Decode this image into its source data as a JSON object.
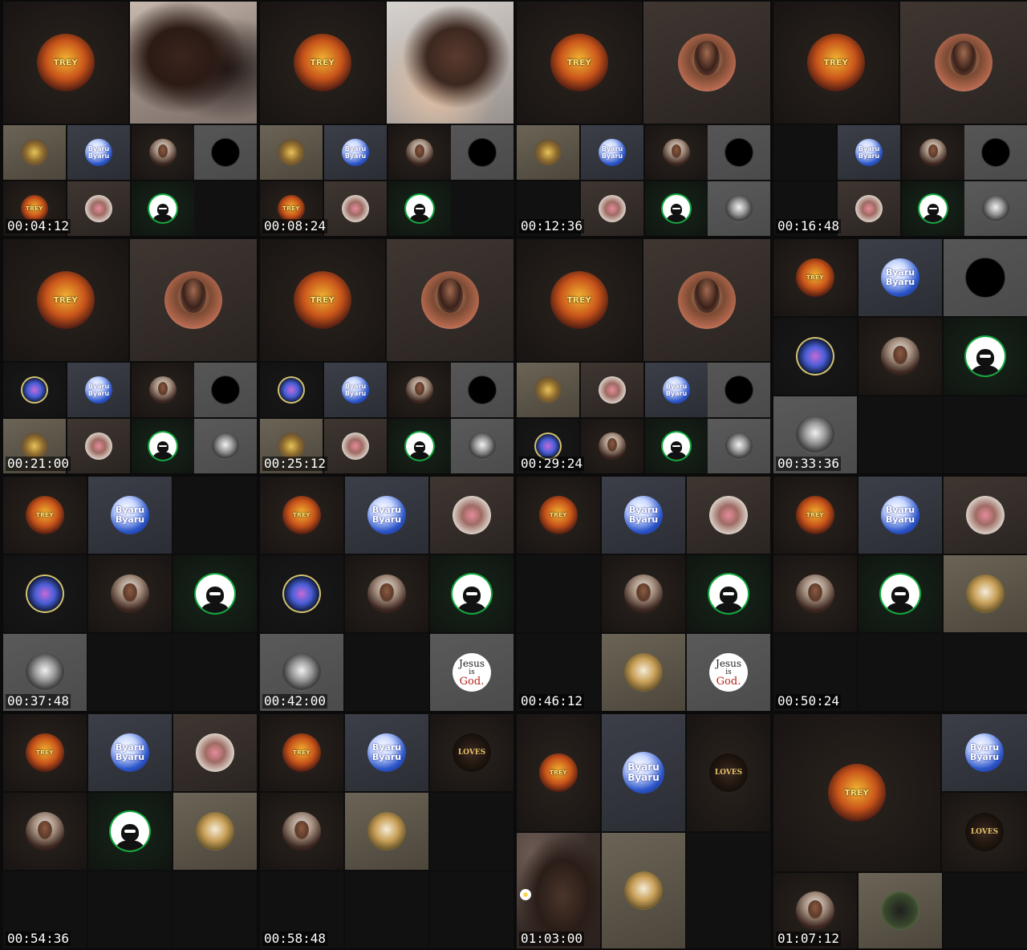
{
  "contact_sheet": {
    "frames": [
      {
        "timestamp": "00:04:12"
      },
      {
        "timestamp": "00:08:24"
      },
      {
        "timestamp": "00:12:36"
      },
      {
        "timestamp": "00:16:48"
      },
      {
        "timestamp": "00:21:00"
      },
      {
        "timestamp": "00:25:12"
      },
      {
        "timestamp": "00:29:24"
      },
      {
        "timestamp": "00:33:36"
      },
      {
        "timestamp": "00:37:48"
      },
      {
        "timestamp": "00:42:00"
      },
      {
        "timestamp": "00:46:12"
      },
      {
        "timestamp": "00:50:24"
      },
      {
        "timestamp": "00:54:36"
      },
      {
        "timestamp": "00:58:48"
      },
      {
        "timestamp": "01:03:00"
      },
      {
        "timestamp": "01:07:12"
      }
    ]
  },
  "avatar_text": {
    "poster": "TREY",
    "byaru_line1": "Byaru",
    "byaru_line2": "Byaru",
    "jesus_line1": "Jesus",
    "jesus_line2": "is",
    "jesus_line3": "God.",
    "loves": "LOVES"
  },
  "colors": {
    "background": "#0b0b0b",
    "timestamp_text": "#ffffff",
    "bot_ring": "#11a83d",
    "jesus_god": "#b8231b"
  }
}
